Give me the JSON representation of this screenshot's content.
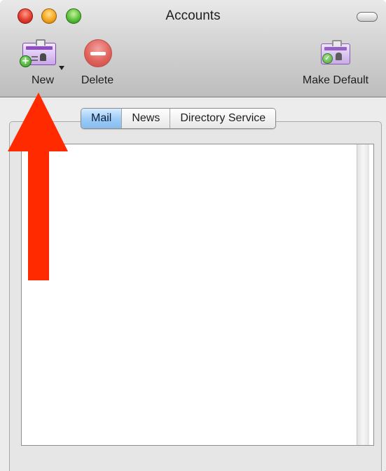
{
  "window": {
    "title": "Accounts"
  },
  "toolbar": {
    "new_label": "New",
    "delete_label": "Delete",
    "make_default_label": "Make Default"
  },
  "tabs": [
    {
      "label": "Mail",
      "selected": true
    },
    {
      "label": "News",
      "selected": false
    },
    {
      "label": "Directory Service",
      "selected": false
    }
  ],
  "accounts_list": [],
  "colors": {
    "close": "#e33b2c",
    "minimize": "#f5a623",
    "zoom": "#58c13a",
    "annotation_arrow": "#ff2a00",
    "selected_tab": "#9fcdf7"
  },
  "icons": {
    "new": "address-card-plus-icon",
    "delete": "delete-minus-icon",
    "make_default": "address-card-check-icon"
  }
}
